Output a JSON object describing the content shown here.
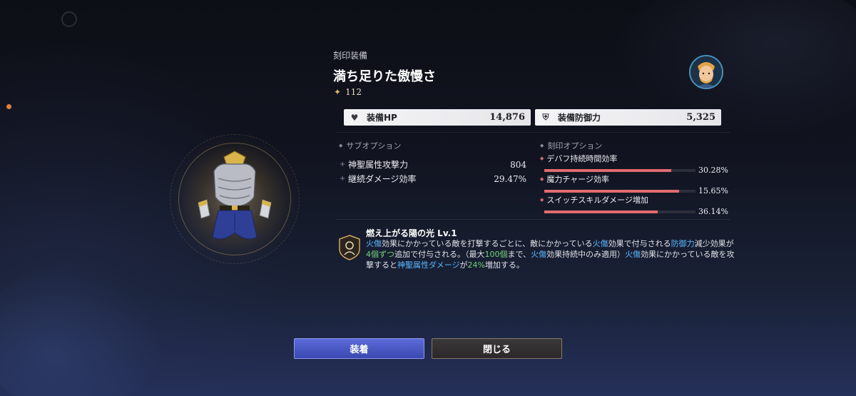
{
  "item": {
    "category": "刻印装備",
    "name": "満ち足りた傲慢さ",
    "level_icon": "sparkle-icon",
    "level": "112"
  },
  "stats": {
    "hp": {
      "label": "装備HP",
      "value": "14,876",
      "icon": "heart-icon"
    },
    "defense": {
      "label": "装備防御力",
      "value": "5,325",
      "icon": "shield-icon"
    }
  },
  "sub_options": {
    "header": "サブオプション",
    "items": [
      {
        "label": "神聖属性攻撃力",
        "value": "804"
      },
      {
        "label": "継続ダメージ効率",
        "value": "29.47%"
      }
    ]
  },
  "seal_options": {
    "header": "刻印オプション",
    "bar_color": "#e16b6e",
    "items": [
      {
        "label": "デバフ持続時間効率",
        "value": "30.28%",
        "fill": 0.84
      },
      {
        "label": "魔力チャージ効率",
        "value": "15.65%",
        "fill": 0.89
      },
      {
        "label": "スイッチスキルダメージ増加",
        "value": "36.14%",
        "fill": 0.75
      }
    ]
  },
  "skill": {
    "name": "燃え上がる陽の光 Lv.1",
    "desc": {
      "p1": "火傷",
      "p2": "効果にかかっている敵を打撃するごとに、敵にかかっている",
      "p3": "火傷",
      "p4": "効果で付与される",
      "p5": "防御力",
      "p6": "減少効果が",
      "p7": "4個ずつ",
      "p8": "追加で付与される。（最大",
      "p9": "100個",
      "p10": "まで、",
      "p11": "火傷",
      "p12": "効果持続中のみ適用）",
      "p13": "火傷",
      "p14": "効果にかかっている敵を攻撃すると",
      "p15": "神聖属性ダメージ",
      "p16": "が",
      "p17": "24%",
      "p18": "増加する。"
    }
  },
  "buttons": {
    "equip": "装着",
    "close": "閉じる"
  },
  "colors": {
    "highlight_blue": "#59b7ff",
    "highlight_green": "#76d27a",
    "equip_button": "#4a58c4"
  }
}
